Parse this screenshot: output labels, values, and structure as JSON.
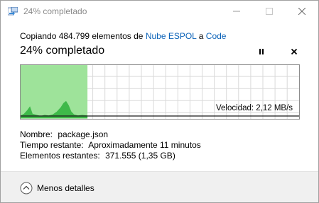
{
  "window": {
    "title": "24% completado",
    "controls": {
      "minimize": "minimize-icon",
      "maximize": "maximize-icon",
      "close": "close-icon"
    }
  },
  "copy": {
    "prefix": "Copiando 484.799 elementos de",
    "source": "Nube ESPOL",
    "connector": "a",
    "destination": "Code"
  },
  "progress": {
    "heading": "24% completado",
    "percent": 24
  },
  "buttons": {
    "pause": "pause-icon",
    "cancel": "close-icon"
  },
  "graph": {
    "speed_label": "Velocidad: 2,12 MB/s",
    "colors": {
      "fill": "#9ee39a",
      "done_area": "#c9f0c2",
      "line": "#3fb94a",
      "grid": "#d9d9d9",
      "border": "#8c8c8c"
    }
  },
  "details": {
    "name_label": "Nombre:",
    "name_value": "package.json",
    "time_label": "Tiempo restante:",
    "time_value": "Aproximadamente 11 minutos",
    "items_label": "Elementos restantes:",
    "items_value": "371.555 (1,35 GB)"
  },
  "footer": {
    "less_details": "Menos detalles",
    "icon": "chevron-up-icon"
  }
}
